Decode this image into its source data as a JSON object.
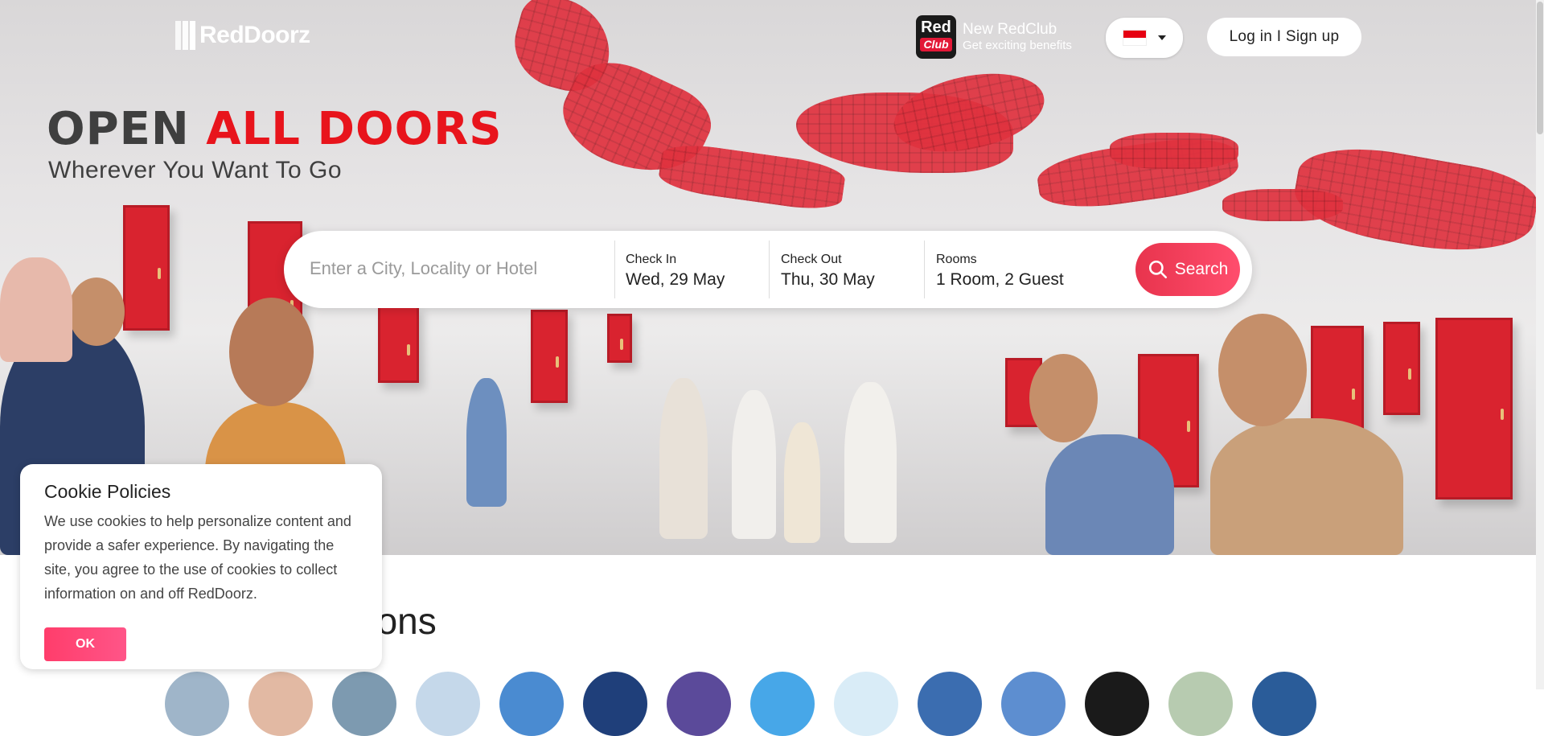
{
  "header": {
    "logo_text": "RedDoorz",
    "redclub": {
      "badge_top": "Red",
      "badge_bottom": "Club",
      "title": "New RedClub",
      "subtitle": "Get exciting benefits"
    },
    "language_flag": "indonesia-flag",
    "login_label": "Log in I Sign up"
  },
  "hero": {
    "headline_dark": "OPEN",
    "headline_red": "ALL DOORS",
    "subheadline": "Wherever You Want To Go"
  },
  "search": {
    "placeholder": "Enter a City, Locality or Hotel",
    "check_in": {
      "label": "Check In",
      "value": "Wed, 29 May"
    },
    "check_out": {
      "label": "Check Out",
      "value": "Thu, 30 May"
    },
    "rooms": {
      "label": "Rooms",
      "value": "1 Room, 2 Guest"
    },
    "button_label": "Search"
  },
  "section": {
    "title_visible": "ations"
  },
  "cookie": {
    "title": "Cookie Policies",
    "body": "We use cookies to help personalize content and provide a safer experience. By navigating the site, you agree to the use of cookies to collect information on and off RedDoorz.",
    "ok_label": "OK"
  },
  "colors": {
    "brand_red": "#e8141c",
    "search_button": "#ff4d6d",
    "cookie_ok": "#ff3d6b"
  }
}
